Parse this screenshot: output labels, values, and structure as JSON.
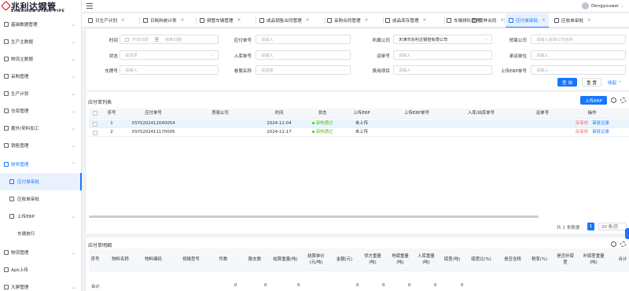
{
  "logo": {
    "main": "兆利达钢管",
    "sub": "ZHAOLIDA STEEL PIPE"
  },
  "sidebar": {
    "items": [
      {
        "label": "基础数据管理",
        "arrow": "⌄"
      },
      {
        "label": "生产主数据",
        "arrow": "⌄"
      },
      {
        "label": "物流主数据",
        "arrow": "⌄"
      },
      {
        "label": "采购管理",
        "arrow": "⌄"
      },
      {
        "label": "生产计划",
        "arrow": "⌄"
      },
      {
        "label": "仓库管理",
        "arrow": "⌄"
      },
      {
        "label": "委外/来料加工",
        "arrow": "⌄"
      },
      {
        "label": "销售管理",
        "arrow": "⌄"
      },
      {
        "label": "财务管理",
        "arrow": "⌃"
      },
      {
        "label": "应付单审批",
        "arrow": ""
      },
      {
        "label": "应收单审批",
        "arrow": ""
      },
      {
        "label": "上传ERP",
        "arrow": "⌄"
      },
      {
        "label": "车辆放行",
        "arrow": ""
      },
      {
        "label": "物流管理",
        "arrow": "⌄"
      },
      {
        "label": "Apk上传",
        "arrow": ""
      },
      {
        "label": "大屏管理",
        "arrow": "⌄"
      }
    ]
  },
  "user": {
    "name": "Dengyouwei",
    "arrow": "⌄"
  },
  "tabs": [
    {
      "label": "日生产计划"
    },
    {
      "label": "日耗料统计表"
    },
    {
      "label": "倒管车辆管理"
    },
    {
      "label": "成品销售合同管理"
    },
    {
      "label": "采购合同管理"
    },
    {
      "label": "成品库存管理"
    },
    {
      "label": "车辆排队管理"
    },
    {
      "label": "委外合同"
    },
    {
      "label": "应付单审批"
    },
    {
      "label": "应收单审批"
    }
  ],
  "filter": {
    "time_label": "时间",
    "time_start": "开始日期",
    "time_sep": "至",
    "time_end": "结束日期",
    "payable_no_label": "应付单号",
    "payable_no_ph": "请输入",
    "company_label": "所属公司",
    "company_value": "天津市兆利达钢管有限公司",
    "trade_company_label": "贸易公司",
    "trade_company_ph": "请输入贸易公司名称",
    "status_label": "状态",
    "status_ph": "请选择",
    "inbound_no_label": "入库单号",
    "inbound_no_ph": "请输入",
    "ship_no_label": "运单号",
    "ship_no_ph": "请输入",
    "carrier_label": "承运单位",
    "carrier_ph": "请输入",
    "plate_label": "车牌号",
    "plate_ph": "请输入",
    "goods_label": "卷筒名称",
    "goods_ph": "请选择",
    "fee_label": "费用项目",
    "fee_ph": "请输入",
    "erp_no_label": "上传ERP单号",
    "erp_no_ph": "请输入",
    "search_btn": "查 询",
    "reset_btn": "重 置",
    "collapse": "收起"
  },
  "list": {
    "title": "应付单列表",
    "upload_btn": "上传ERP",
    "columns": [
      "序号",
      "应付单号",
      "贸易公司",
      "时间",
      "状态",
      "上传ERP",
      "上传ERP单号",
      "入库/出库单号",
      "运单号",
      "操作"
    ],
    "rows": [
      {
        "idx": "1",
        "no": "XSYS202412040054",
        "trade": "",
        "time": "2024-12-04",
        "status": "审核通过",
        "erp": "未上传",
        "erp_no": "",
        "io_no": "",
        "ship_no": "",
        "act1": "反审核",
        "act2": "审批记录"
      },
      {
        "idx": "2",
        "no": "XSYS202411170005",
        "trade": "",
        "time": "2024-11-17",
        "status": "审核通过",
        "erp": "未上传",
        "erp_no": "",
        "io_no": "",
        "ship_no": "",
        "act1": "反审核",
        "act2": "审批记录"
      }
    ],
    "total_text": "共 2 条数据",
    "page": "1",
    "page_size": "20 条/页"
  },
  "detail": {
    "title": "应付单明细",
    "columns": [
      "序号",
      "物料名称",
      "物料编码",
      "规格型号",
      "件数",
      "散支数",
      "结算重量(吨)",
      "结算单价\n(元/吨)",
      "金额(元)",
      "供方重量\n(吨)",
      "地磅重量\n(吨)",
      "入库重量\n(吨)",
      "磅差(吨)",
      "磅差比(%)",
      "是否含税",
      "税率(%)",
      "是否补磅\n差",
      "补磅差重量\n(吨)",
      "合计"
    ],
    "sum_label": "合计",
    "sum_values": [
      "0",
      "0",
      "0",
      "0",
      "0",
      "0",
      "0",
      "0"
    ]
  }
}
